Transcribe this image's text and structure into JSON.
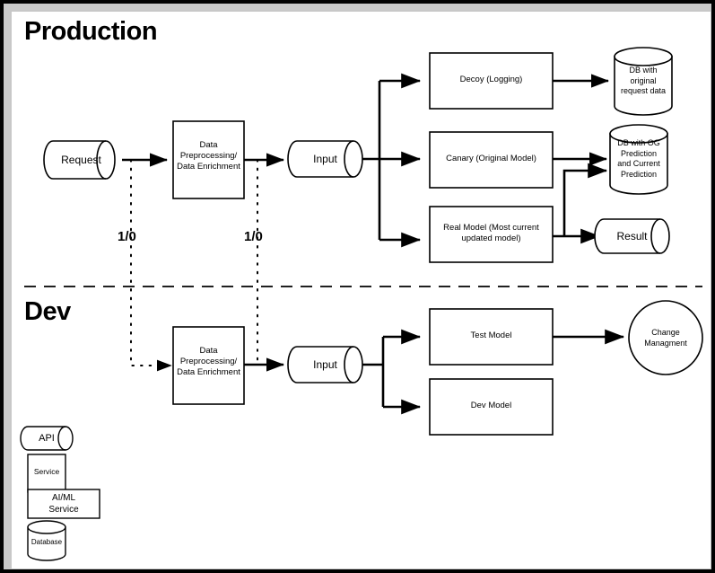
{
  "diagram": {
    "title_production": "Production",
    "title_dev": "Dev",
    "edge_labels": {
      "prod_request_split": "1/0",
      "prod_input_split": "1/0"
    },
    "production": {
      "request": "Request",
      "preprocessing": "Data\nPreprocessing/\nData Enrichment",
      "input": "Input",
      "decoy": "Decoy (Logging)",
      "canary": "Canary (Original Model)",
      "real_model": "Real Model (Most current\nupdated model)",
      "db_original": "DB with\noriginal\nrequest data",
      "db_predictions": "DB with OG\nPrediction\nand Current\nPrediction",
      "result": "Result"
    },
    "dev": {
      "preprocessing": "Data\nPreprocessing/\nData Enrichment",
      "input": "Input",
      "test_model": "Test Model",
      "dev_model": "Dev Model",
      "change_management": "Change\nManagment"
    },
    "legend": [
      {
        "key": "api",
        "label": "API",
        "shape": "cylinder-horizontal"
      },
      {
        "key": "service",
        "label": "Service",
        "shape": "rectangle"
      },
      {
        "key": "aiml",
        "label": "AI/ML\nService",
        "shape": "rectangle"
      },
      {
        "key": "database",
        "label": "Database",
        "shape": "cylinder-vertical"
      }
    ],
    "colors": {
      "stroke": "#000000",
      "fill": "#ffffff",
      "page_border": "#000000",
      "inner_border": "#c8c8c8"
    }
  }
}
